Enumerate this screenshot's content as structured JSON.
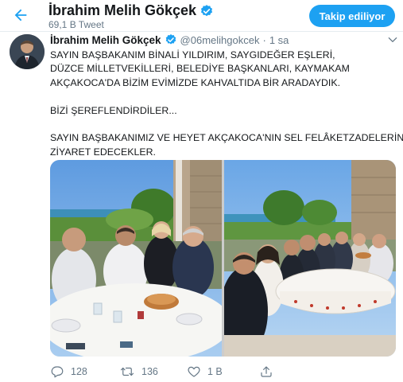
{
  "header": {
    "title": "İbrahim Melih Gökçek",
    "tweet_count": "69,1 B Tweet",
    "follow_label": "Takip ediliyor"
  },
  "tweet": {
    "author_name": "İbrahim Melih Gökçek",
    "handle": "@06melihgokcek",
    "separator": "·",
    "timestamp": "1 sa",
    "lines": [
      "SAYIN BAŞBAKANIM BİNALİ YILDIRIM, SAYGIDEĞER EŞLERİ,",
      "DÜZCE MİLLETVEKİLLERİ, BELEDİYE BAŞKANLARI, KAYMAKAM",
      "AKÇAKOCA'DA BİZİM EVİMİZDE KAHVALTIDA BİR ARADAYDIK.",
      "",
      "BİZİ ŞEREFLENDİRDİLER...",
      "",
      "SAYIN BAŞBAKANIMIZ VE HEYET AKÇAKOCA'NIN SEL FELÂKETZADELERİNİ",
      "ZİYARET EDECEKLER."
    ]
  },
  "actions": {
    "replies": "128",
    "retweets": "136",
    "likes": "1 B"
  },
  "icons": {
    "back": "back-arrow-icon",
    "verified": "verified-badge-icon",
    "more": "chevron-down-icon",
    "reply": "reply-icon",
    "retweet": "retweet-icon",
    "like": "heart-icon",
    "share": "share-icon"
  },
  "colors": {
    "accent": "#1da1f2",
    "secondary_text": "#657786",
    "primary_text": "#14171a"
  }
}
